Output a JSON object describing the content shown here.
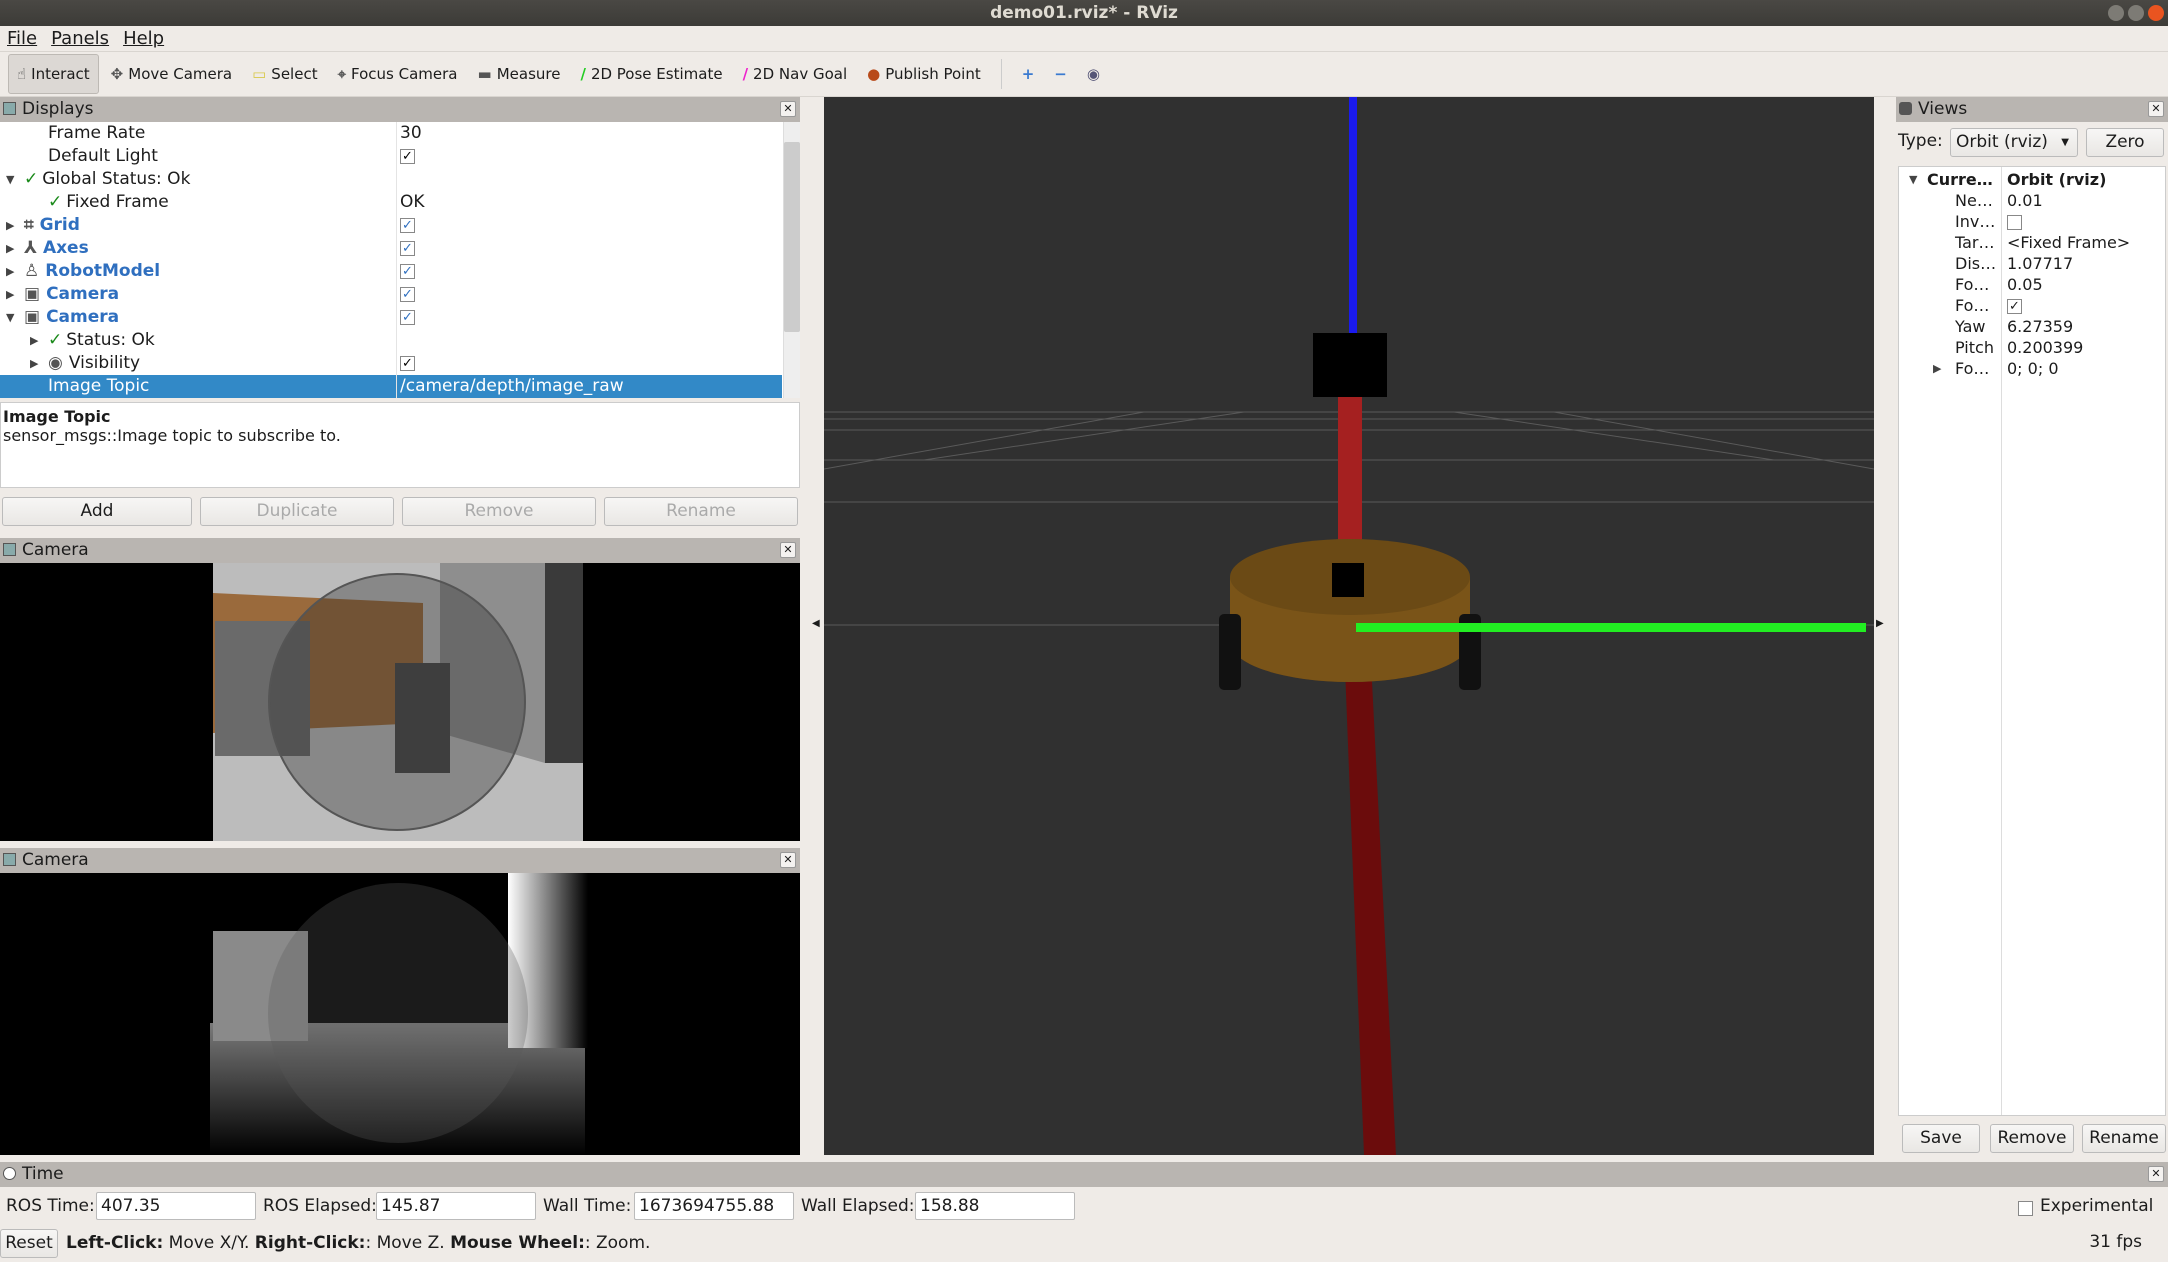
{
  "window": {
    "title": "demo01.rviz* - RViz"
  },
  "menu": [
    "File",
    "Panels",
    "Help"
  ],
  "toolbar": {
    "tools": [
      {
        "label": "Interact",
        "icon": "hand-icon",
        "active": true
      },
      {
        "label": "Move Camera",
        "icon": "move-camera-icon"
      },
      {
        "label": "Select",
        "icon": "select-icon"
      },
      {
        "label": "Focus Camera",
        "icon": "focus-camera-icon"
      },
      {
        "label": "Measure",
        "icon": "ruler-icon"
      },
      {
        "label": "2D Pose Estimate",
        "icon": "green-arrow-icon"
      },
      {
        "label": "2D Nav Goal",
        "icon": "pink-arrow-icon"
      },
      {
        "label": "Publish Point",
        "icon": "map-pin-icon"
      }
    ]
  },
  "displays": {
    "title": "Displays",
    "rows": [
      {
        "name": "Frame Rate",
        "value": "30",
        "indent": 1
      },
      {
        "name": "Default Light",
        "check": true,
        "indent": 1
      },
      {
        "name": "Global Status: Ok",
        "status": true,
        "expanded": true,
        "indent": 0
      },
      {
        "name": "Fixed Frame",
        "value": "OK",
        "status": true,
        "indent": 1
      },
      {
        "name": "Grid",
        "check": true,
        "blue": true,
        "collapsed": true,
        "icon": "grid-icon"
      },
      {
        "name": "Axes",
        "check": true,
        "blue": true,
        "collapsed": true,
        "icon": "axes-icon"
      },
      {
        "name": "RobotModel",
        "check": true,
        "blue": true,
        "collapsed": true,
        "icon": "robot-icon"
      },
      {
        "name": "Camera",
        "check": true,
        "blue": true,
        "collapsed": true,
        "icon": "camera-icon"
      },
      {
        "name": "Camera",
        "check": true,
        "blue": true,
        "expanded": true,
        "icon": "camera-icon"
      },
      {
        "name": "Status: Ok",
        "status": true,
        "collapsed": true,
        "indent": 1
      },
      {
        "name": "Visibility",
        "check": true,
        "collapsed": true,
        "indent": 1,
        "icon": "eye-icon"
      },
      {
        "name": "Image Topic",
        "value": "/camera/depth/image_raw",
        "indent": 1,
        "selected": true
      }
    ],
    "desc_title": "Image Topic",
    "desc_text": "sensor_msgs::Image topic to subscribe to.",
    "buttons": {
      "add": "Add",
      "duplicate": "Duplicate",
      "remove": "Remove",
      "rename": "Rename"
    }
  },
  "camera1": {
    "title": "Camera"
  },
  "camera2": {
    "title": "Camera"
  },
  "views": {
    "title": "Views",
    "type_label": "Type:",
    "type_value": "Orbit (rviz)",
    "zero": "Zero",
    "rows": [
      {
        "k": "Curre…",
        "v": "Orbit (rviz)",
        "bold": true
      },
      {
        "k": "Ne…",
        "v": "0.01"
      },
      {
        "k": "Inv…",
        "check": false
      },
      {
        "k": "Tar…",
        "v": "<Fixed Frame>"
      },
      {
        "k": "Dis…",
        "v": "1.07717"
      },
      {
        "k": "Fo…",
        "v": "0.05"
      },
      {
        "k": "Fo…",
        "check": true
      },
      {
        "k": "Yaw",
        "v": "6.27359"
      },
      {
        "k": "Pitch",
        "v": "0.200399"
      },
      {
        "k": "Fo…",
        "v": "0; 0; 0",
        "collapsed": true
      }
    ],
    "save": "Save",
    "remove": "Remove",
    "rename": "Rename"
  },
  "time": {
    "title": "Time",
    "ros_time_label": "ROS Time:",
    "ros_time": "407.35",
    "ros_elapsed_label": "ROS Elapsed:",
    "ros_elapsed": "145.87",
    "wall_time_label": "Wall Time:",
    "wall_time": "1673694755.88",
    "wall_elapsed_label": "Wall Elapsed:",
    "wall_elapsed": "158.88",
    "experimental": "Experimental"
  },
  "status": {
    "reset": "Reset",
    "hint_b1": "Left-Click:",
    "hint_1": " Move X/Y. ",
    "hint_b2": "Right-Click:",
    "hint_2": ": Move Z. ",
    "hint_b3": "Mouse Wheel:",
    "hint_3": ": Zoom.",
    "fps": "31 fps"
  }
}
